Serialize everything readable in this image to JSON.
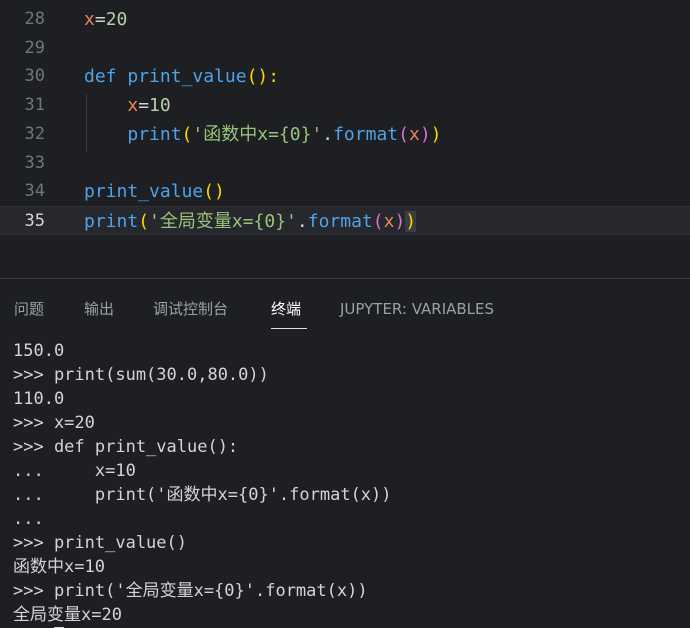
{
  "editor": {
    "lines": [
      {
        "num": "28",
        "code": [
          {
            "t": "x",
            "c": "var"
          },
          {
            "t": "=",
            "c": "op"
          },
          {
            "t": "20",
            "c": "num"
          }
        ]
      },
      {
        "num": "29",
        "code": []
      },
      {
        "num": "30",
        "code": [
          {
            "t": "def ",
            "c": "kw"
          },
          {
            "t": "print_value",
            "c": "fn"
          },
          {
            "t": "():",
            "c": "p1"
          }
        ]
      },
      {
        "num": "31",
        "code": [
          {
            "t": "    ",
            "c": "op"
          },
          {
            "t": "x",
            "c": "var"
          },
          {
            "t": "=",
            "c": "op"
          },
          {
            "t": "10",
            "c": "num"
          }
        ]
      },
      {
        "num": "32",
        "code": [
          {
            "t": "    ",
            "c": "op"
          },
          {
            "t": "print",
            "c": "fn"
          },
          {
            "t": "(",
            "c": "p1"
          },
          {
            "t": "'函数中x={0}'",
            "c": "str"
          },
          {
            "t": ".",
            "c": "op"
          },
          {
            "t": "format",
            "c": "method"
          },
          {
            "t": "(",
            "c": "p2"
          },
          {
            "t": "x",
            "c": "arg"
          },
          {
            "t": ")",
            "c": "p2"
          },
          {
            "t": ")",
            "c": "p1"
          }
        ]
      },
      {
        "num": "33",
        "code": []
      },
      {
        "num": "34",
        "code": [
          {
            "t": "print_value",
            "c": "fn"
          },
          {
            "t": "()",
            "c": "p1"
          }
        ]
      },
      {
        "num": "35",
        "code": [
          {
            "t": "print",
            "c": "fn"
          },
          {
            "t": "(",
            "c": "p1"
          },
          {
            "t": "'全局变量x={0}'",
            "c": "str"
          },
          {
            "t": ".",
            "c": "op"
          },
          {
            "t": "format",
            "c": "method"
          },
          {
            "t": "(",
            "c": "p2"
          },
          {
            "t": "x",
            "c": "arg"
          },
          {
            "t": ")",
            "c": "p2"
          },
          {
            "t": ")",
            "c": "p1cur"
          }
        ]
      }
    ],
    "current_line": "35"
  },
  "panel": {
    "tabs": [
      {
        "label": "问题",
        "active": false
      },
      {
        "label": "输出",
        "active": false
      },
      {
        "label": "调试控制台",
        "active": false
      },
      {
        "label": "终端",
        "active": true
      },
      {
        "label": "JUPYTER: VARIABLES",
        "active": false
      }
    ]
  },
  "terminal": {
    "lines": [
      "150.0",
      ">>> print(sum(30.0,80.0))",
      "110.0",
      ">>> x=20",
      ">>> def print_value():",
      "...     x=10",
      "...     print('函数中x={0}'.format(x))",
      "...",
      ">>> print_value()",
      "函数中x=10",
      ">>> print('全局变量x={0}'.format(x))",
      "全局变量x=20",
      ">>> "
    ]
  },
  "colors": {
    "background": "#1e1f22",
    "variable": "#e8845c",
    "keyword": "#4fa3e8",
    "string": "#98c379",
    "bracket_1": "#ffd700",
    "bracket_2": "#da70d6"
  }
}
